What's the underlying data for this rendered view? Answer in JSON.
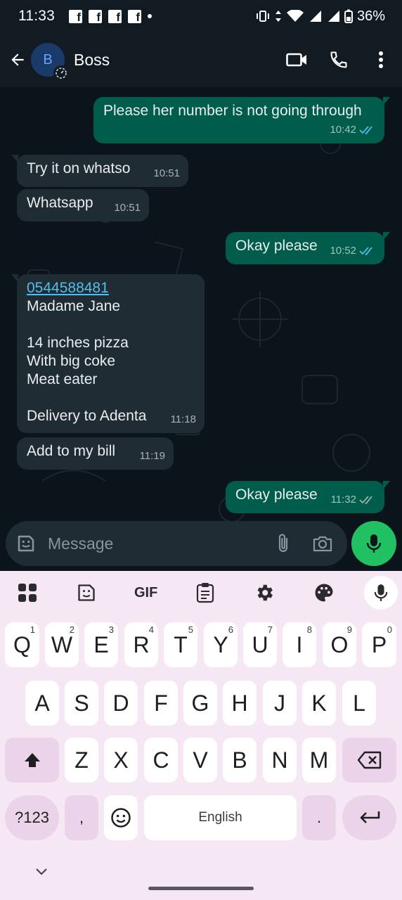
{
  "status_bar": {
    "time": "11:33",
    "battery": "36%",
    "icons": [
      "facebook-icon",
      "facebook-icon",
      "facebook-icon",
      "facebook-icon",
      "dot-icon",
      "vibrate-icon",
      "data-arrows-icon",
      "wifi-icon",
      "signal-icon",
      "signal-icon",
      "battery-icon"
    ]
  },
  "header": {
    "avatar_letter": "B",
    "contact_name": "Boss",
    "actions": [
      "video-call-icon",
      "phone-icon",
      "more-vert-icon"
    ]
  },
  "messages": [
    {
      "dir": "out",
      "text": "Please her number is not going through",
      "time": "10:42",
      "status": "read"
    },
    {
      "dir": "in",
      "text": "Try it on whatso",
      "time": "10:51"
    },
    {
      "dir": "in",
      "text": "Whatsapp",
      "time": "10:51"
    },
    {
      "dir": "out",
      "text": "Okay please",
      "time": "10:52",
      "status": "read"
    },
    {
      "dir": "in",
      "link": "0544588481",
      "lines": [
        "Madame Jane",
        "",
        "14 inches pizza",
        "With big coke",
        "Meat eater",
        "",
        "Delivery to Adenta"
      ],
      "time": "11:18"
    },
    {
      "dir": "in",
      "text": "Add to my bill",
      "time": "11:19"
    },
    {
      "dir": "out",
      "text": "Okay please",
      "time": "11:32",
      "status": "delivered"
    }
  ],
  "composer": {
    "placeholder": "Message",
    "icons": [
      "sticker-icon",
      "attach-icon",
      "camera-icon",
      "mic-icon"
    ]
  },
  "keyboard": {
    "toolbar": [
      "apps-grid-icon",
      "sticker-icon",
      "GIF",
      "clipboard-icon",
      "settings-icon",
      "palette-icon",
      "mic-icon"
    ],
    "row1": [
      "Q",
      "W",
      "E",
      "R",
      "T",
      "Y",
      "U",
      "I",
      "O",
      "P"
    ],
    "row1_hints": [
      "1",
      "2",
      "3",
      "4",
      "5",
      "6",
      "7",
      "8",
      "9",
      "0"
    ],
    "row2": [
      "A",
      "S",
      "D",
      "F",
      "G",
      "H",
      "J",
      "K",
      "L"
    ],
    "row3": [
      "Z",
      "X",
      "C",
      "V",
      "B",
      "N",
      "M"
    ],
    "symbols_key": "?123",
    "comma_key": ",",
    "space_label": "English",
    "period_key": ".",
    "colors": {
      "background": "#f6e7f4",
      "key": "#ffffff",
      "function_key": "#ebd3e9"
    }
  },
  "colors": {
    "chat_bg": "#0b141a",
    "incoming_bubble": "#202c33",
    "outgoing_bubble": "#005c4b",
    "read_ticks": "#53bdeb",
    "accent_green": "#21c063"
  }
}
